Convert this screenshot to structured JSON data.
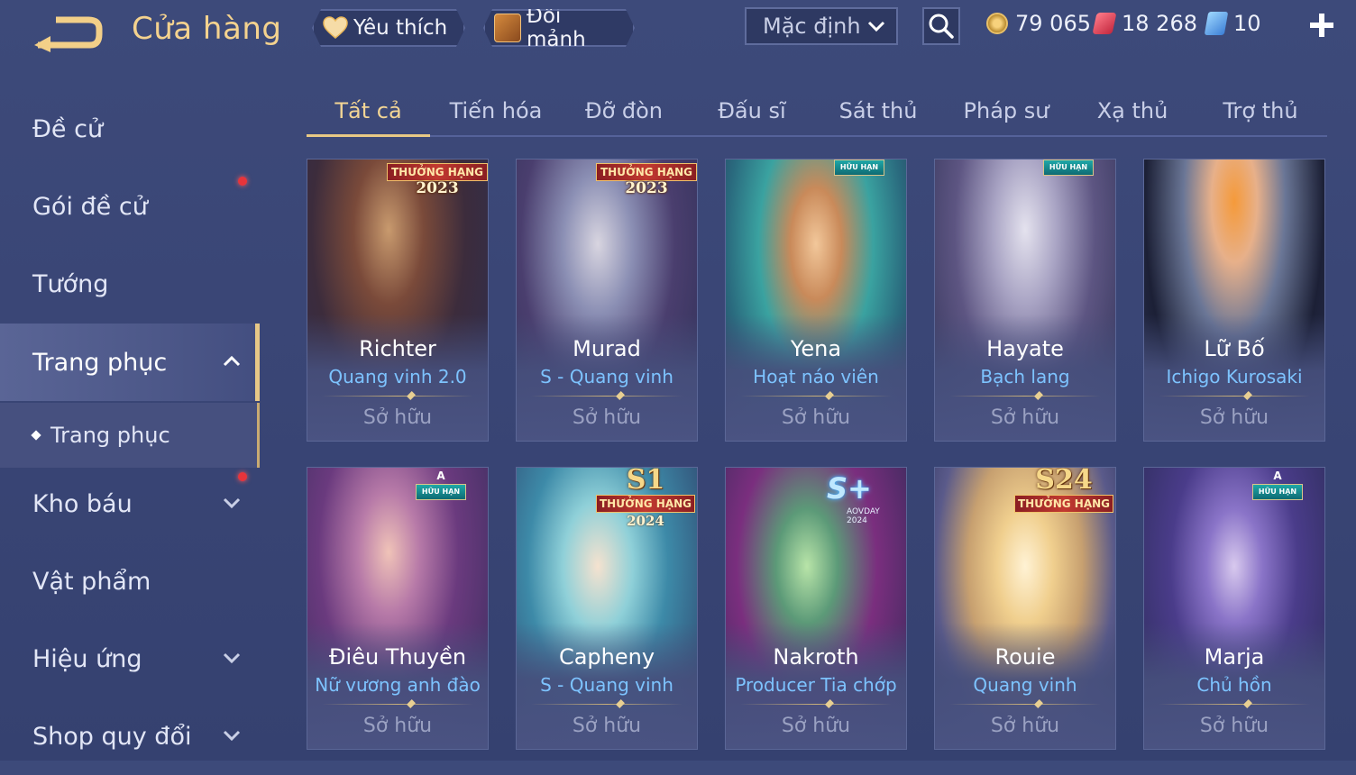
{
  "header": {
    "title": "Cửa hàng",
    "favorite_label": "Yêu thích",
    "shard_label": "Đổi mảnh",
    "sort_value": "Mặc định",
    "currencies": {
      "gold": "79 065",
      "ruby": "18 268",
      "gem": "10"
    }
  },
  "sidebar": {
    "items": [
      {
        "label": "Đề cử"
      },
      {
        "label": "Gói đề cử"
      },
      {
        "label": "Tướng"
      },
      {
        "label": "Trang phục"
      },
      {
        "label": "Trang phục"
      },
      {
        "label": "Kho báu"
      },
      {
        "label": "Vật phẩm"
      },
      {
        "label": "Hiệu ứng"
      },
      {
        "label": "Shop quy đổi"
      }
    ]
  },
  "tabs": [
    {
      "label": "Tất cả"
    },
    {
      "label": "Tiến hóa"
    },
    {
      "label": "Đỡ đòn"
    },
    {
      "label": "Đấu sĩ"
    },
    {
      "label": "Sát thủ"
    },
    {
      "label": "Pháp sư"
    },
    {
      "label": "Xạ thủ"
    },
    {
      "label": "Trợ thủ"
    }
  ],
  "badges": {
    "rank_label": "THƯỞNG HẠNG",
    "limited_label": "HỮU HẠN",
    "a_letter": "A",
    "year_2023": "2023",
    "year_2024": "2024",
    "s1": "S1",
    "s24": "S24",
    "splus": "S+",
    "aovday": "AOVDAY 2024"
  },
  "cards": [
    {
      "hero": "Richter",
      "skin": "Quang vinh 2.0",
      "status": "Sở hữu"
    },
    {
      "hero": "Murad",
      "skin": "S - Quang vinh",
      "status": "Sở hữu"
    },
    {
      "hero": "Yena",
      "skin": "Hoạt náo viên",
      "status": "Sở hữu"
    },
    {
      "hero": "Hayate",
      "skin": "Bạch lang",
      "status": "Sở hữu"
    },
    {
      "hero": "Lữ Bố",
      "skin": "Ichigo Kurosaki",
      "status": "Sở hữu"
    },
    {
      "hero": "Điêu Thuyền",
      "skin": "Nữ vương anh đào",
      "status": "Sở hữu"
    },
    {
      "hero": "Capheny",
      "skin": "S - Quang vinh",
      "status": "Sở hữu"
    },
    {
      "hero": "Nakroth",
      "skin": "Producer Tia chớp",
      "status": "Sở hữu"
    },
    {
      "hero": "Rouie",
      "skin": "Quang vinh",
      "status": "Sở hữu"
    },
    {
      "hero": "Marja",
      "skin": "Chủ hồn",
      "status": "Sở hữu"
    }
  ]
}
